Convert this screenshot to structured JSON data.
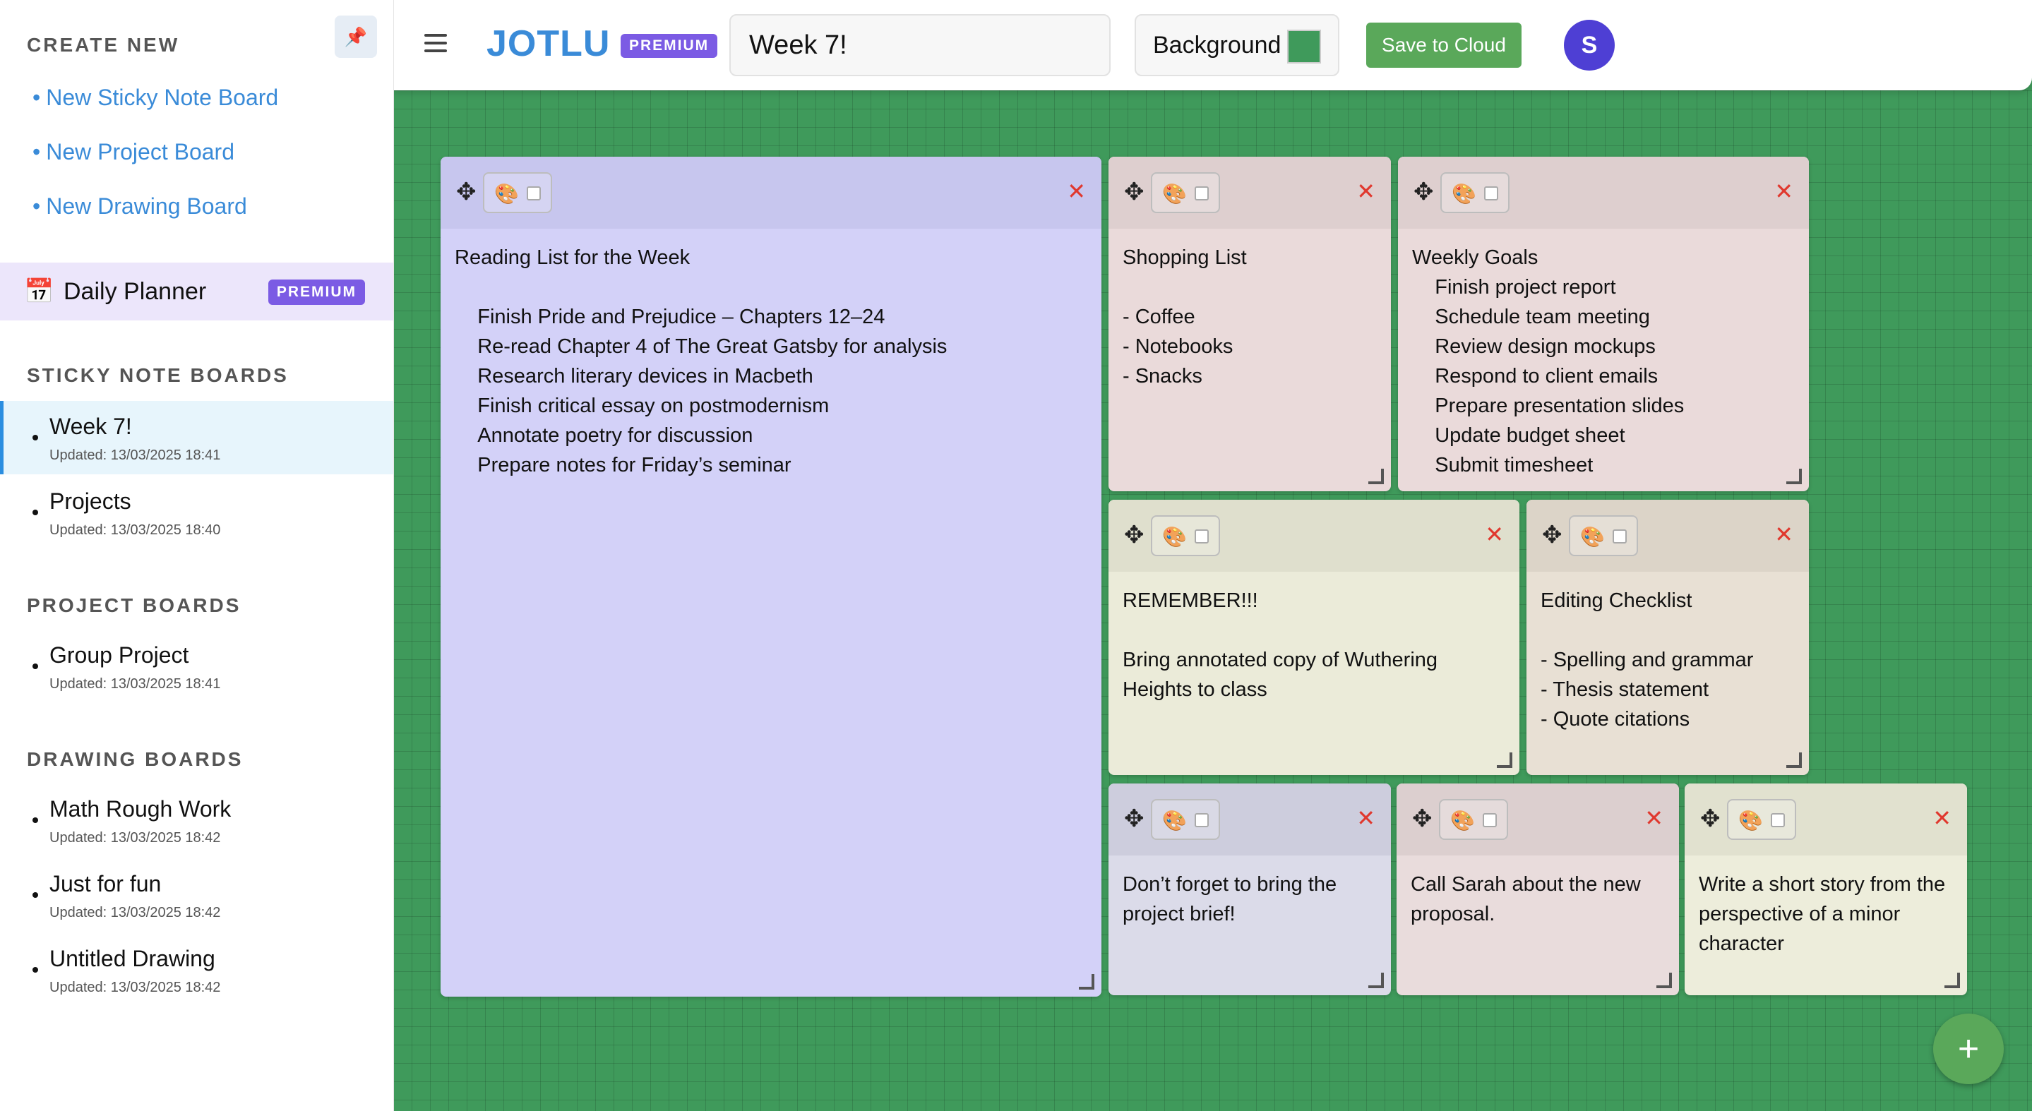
{
  "sidebar": {
    "create_title": "CREATE NEW",
    "create_links": [
      {
        "label": "New Sticky Note Board"
      },
      {
        "label": "New Project Board"
      },
      {
        "label": "New Drawing Board"
      }
    ],
    "planner": {
      "label": "Daily Planner",
      "badge": "PREMIUM",
      "icon": "📅"
    },
    "sticky_title": "STICKY NOTE BOARDS",
    "sticky_boards": [
      {
        "name": "Week 7!",
        "updated": "Updated: 13/03/2025 18:41"
      },
      {
        "name": "Projects",
        "updated": "Updated: 13/03/2025 18:40"
      }
    ],
    "project_title": "PROJECT BOARDS",
    "project_boards": [
      {
        "name": "Group Project",
        "updated": "Updated: 13/03/2025 18:41"
      }
    ],
    "drawing_title": "DRAWING BOARDS",
    "drawing_boards": [
      {
        "name": "Math Rough Work",
        "updated": "Updated: 13/03/2025 18:42"
      },
      {
        "name": "Just for fun",
        "updated": "Updated: 13/03/2025 18:42"
      },
      {
        "name": "Untitled Drawing",
        "updated": "Updated: 13/03/2025 18:42"
      }
    ]
  },
  "header": {
    "logo": "JOTLU",
    "badge": "PREMIUM",
    "board_title": "Week 7!",
    "background_label": "Background",
    "background_color": "#3f9a5b",
    "save_label": "Save to Cloud",
    "avatar_initial": "S"
  },
  "notes": [
    {
      "text": "Reading List for the Week\n\n    Finish Pride and Prejudice – Chapters 12–24\n    Re-read Chapter 4 of The Great Gatsby for analysis\n    Research literary devices in Macbeth\n    Finish critical essay on postmodernism\n    Annotate poetry for discussion\n    Prepare notes for Friday’s seminar",
      "head_color": "#c7c6ee",
      "body_color": "#d3d1f8"
    },
    {
      "text": "Shopping List\n\n- Coffee\n- Notebooks\n- Snacks",
      "head_color": "#decfcf",
      "body_color": "#eadada"
    },
    {
      "text": "Weekly Goals\n    Finish project report\n    Schedule team meeting\n    Review design mockups\n    Respond to client emails\n    Prepare presentation slides\n    Update budget sheet\n    Submit timesheet",
      "head_color": "#decfcf",
      "body_color": "#eadada"
    },
    {
      "text": "REMEMBER!!!\n\nBring annotated copy of Wuthering Heights to class",
      "head_color": "#dfdfcd",
      "body_color": "#ebebd9"
    },
    {
      "text": "Editing Checklist\n\n- Spelling and grammar\n- Thesis statement\n- Quote citations",
      "head_color": "#dcd4c8",
      "body_color": "#e8e0d4"
    },
    {
      "text": "Don’t forget to bring the project brief!",
      "head_color": "#cdcddd",
      "body_color": "#dbdbe9"
    },
    {
      "text": "Call Sarah about the new proposal.",
      "head_color": "#dccfcf",
      "body_color": "#e9dcdc"
    },
    {
      "text": "Write a short story from the perspective of a minor character",
      "head_color": "#e1e1cf",
      "body_color": "#ededdb"
    }
  ],
  "icons": {
    "pin": "📌",
    "move": "✥",
    "palette": "🎨",
    "close": "✕",
    "add": "+"
  }
}
